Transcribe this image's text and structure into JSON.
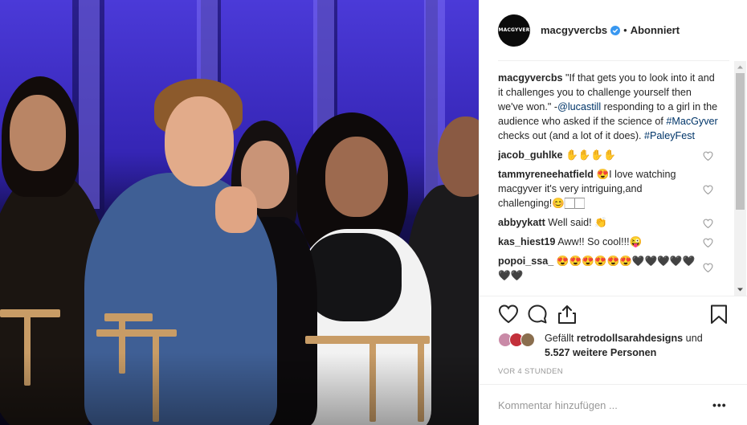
{
  "post": {
    "photo_alt": "Panel photo",
    "header": {
      "avatar_text": "MACGYVER",
      "username": "macgyvercbs",
      "separator": "•",
      "follow_status": "Abonniert"
    },
    "caption": {
      "username": "macgyvercbs",
      "text_1": " \"If that gets you to look into it and it challenges you to challenge yourself then we've won.\" -",
      "mention": "@lucastill",
      "text_2": " responding to a girl in the audience who asked if the science of ",
      "hashtag_1": "#MacGyver",
      "text_3": " checks out (and a lot of it does). ",
      "hashtag_2": "#PaleyFest"
    },
    "comments": [
      {
        "username": "jacob_guhlke",
        "text": " ✋✋✋✋"
      },
      {
        "username": "tammyreneehatfield",
        "text": " 😍I love watching macgyver it's very intriguing,and challenging!😊🏻🏻"
      },
      {
        "username": "abbyykatt",
        "text": " Well said! 👏"
      },
      {
        "username": "kas_hiest19",
        "text": " Aww!! So cool!!!😜"
      },
      {
        "username": "popoi_ssa_",
        "text": " 😍😍😍😍😍😍🖤🖤🖤🖤🖤🖤🖤"
      }
    ],
    "likes": {
      "prefix": "Gefällt ",
      "user": "retrodollsarahdesigns",
      "middle": " und ",
      "count": "5.527 weitere Personen"
    },
    "time_ago": "VOR 4 STUNDEN",
    "comment_input": {
      "placeholder": "Kommentar hinzufügen ..."
    },
    "more_label": "•••",
    "colors": {
      "link": "#003569",
      "verified": "#3897f0",
      "muted": "#999999"
    },
    "icons": [
      "heart-icon",
      "comment-icon",
      "share-icon",
      "bookmark-icon",
      "verified-badge-icon",
      "more-options-icon"
    ]
  }
}
